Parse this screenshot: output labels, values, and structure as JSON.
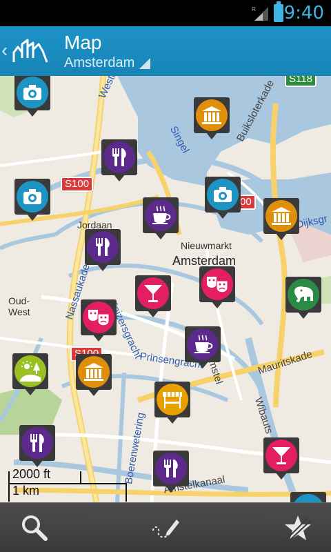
{
  "status_bar": {
    "time": "9:40",
    "network": "R"
  },
  "action_bar": {
    "title": "Map",
    "subtitle": "Amsterdam"
  },
  "map": {
    "labels": {
      "jordaan": "Jordaan",
      "nieuwmarkt": "Nieuwmarkt",
      "amsterdam": "Amsterdam",
      "oud_west_1": "Oud-",
      "oud_west_2": "West"
    },
    "road_signs": {
      "s118": "S118",
      "s100a": "S100",
      "s100b": "00",
      "s100c": "S100"
    },
    "streets": {
      "westerkade": "Westerkade",
      "singel": "Singel",
      "bulksloterkade": "Buiksloterkade",
      "nassaukade": "Nassaukade",
      "keizersgracht": "Keizersgracht",
      "prinsengracht": "Prinsengracht",
      "mauritskade": "Mauritskade",
      "boerenwetering": "Boerenwetering",
      "amstelkanaal": "Amstelkanaal",
      "dijksgr": "Dijksgr",
      "wibaut": "Wibauts",
      "amstel": "Amstel"
    },
    "scale": {
      "imperial": "2000 ft",
      "metric": "1 km"
    },
    "category_colors": {
      "museum": "#e08f0c",
      "restaurant": "#5b2a8a",
      "theater": "#e41e63",
      "nightlife": "#e41e63",
      "cafe": "#5b2a8a",
      "photo": "#1d94c4",
      "park": "#9bc022",
      "zoo": "#2b8a45",
      "market": "#e8a000"
    }
  },
  "bottom_bar": {
    "search_icon": "search-icon",
    "route_icon": "route-draw-icon",
    "favorites_icon": "favorites-icon"
  }
}
